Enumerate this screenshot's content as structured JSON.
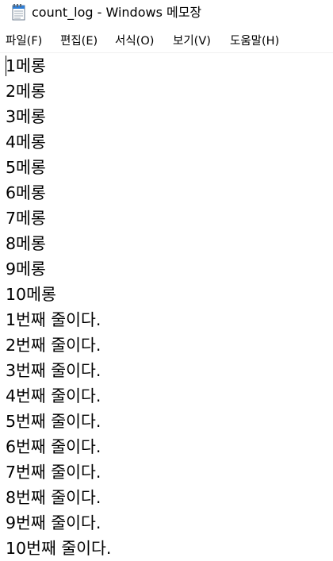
{
  "window": {
    "title": "count_log - Windows 메모장"
  },
  "menu": {
    "items": [
      {
        "label": "파일(F)"
      },
      {
        "label": "편집(E)"
      },
      {
        "label": "서식(O)"
      },
      {
        "label": "보기(V)"
      },
      {
        "label": "도움말(H)"
      }
    ]
  },
  "editor": {
    "lines": [
      "1메롱",
      "2메롱",
      "3메롱",
      "4메롱",
      "5메롱",
      "6메롱",
      "7메롱",
      "8메롱",
      "9메롱",
      "10메롱",
      "1번째 줄이다.",
      "2번째 줄이다.",
      "3번째 줄이다.",
      "4번째 줄이다.",
      "5번째 줄이다.",
      "6번째 줄이다.",
      "7번째 줄이다.",
      "8번째 줄이다.",
      "9번째 줄이다.",
      "10번째 줄이다."
    ]
  },
  "colors": {
    "background": "#ffffff",
    "text": "#000000",
    "icon_blue": "#2f7fd8"
  },
  "icons": {
    "app": "notepad-icon"
  }
}
